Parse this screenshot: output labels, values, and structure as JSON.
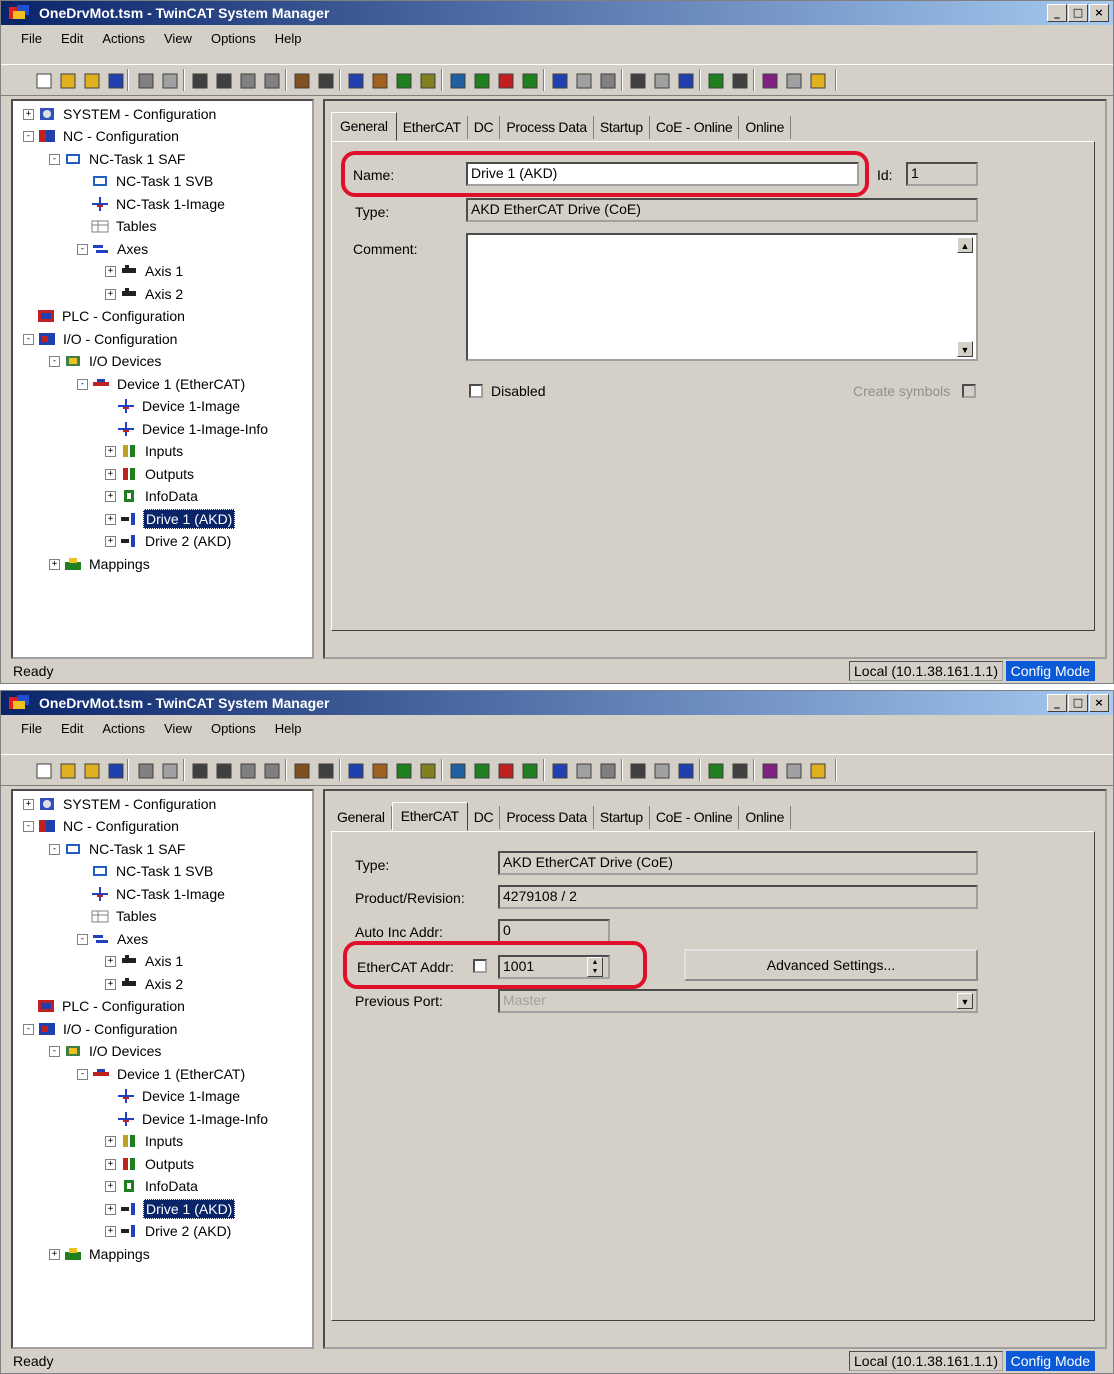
{
  "window1": {
    "title": "OneDrvMot.tsm - TwinCAT System Manager",
    "menu": [
      "File",
      "Edit",
      "Actions",
      "View",
      "Options",
      "Help"
    ],
    "tree": [
      {
        "label": "SYSTEM - Configuration"
      },
      {
        "label": "NC - Configuration"
      },
      {
        "label": "NC-Task 1 SAF"
      },
      {
        "label": "NC-Task 1 SVB"
      },
      {
        "label": "NC-Task 1-Image"
      },
      {
        "label": "Tables"
      },
      {
        "label": "Axes"
      },
      {
        "label": "Axis 1"
      },
      {
        "label": "Axis 2"
      },
      {
        "label": "PLC - Configuration"
      },
      {
        "label": "I/O - Configuration"
      },
      {
        "label": "I/O Devices"
      },
      {
        "label": "Device 1 (EtherCAT)"
      },
      {
        "label": "Device 1-Image"
      },
      {
        "label": "Device 1-Image-Info"
      },
      {
        "label": "Inputs"
      },
      {
        "label": "Outputs"
      },
      {
        "label": "InfoData"
      },
      {
        "label": "Drive 1 (AKD)"
      },
      {
        "label": "Drive 2 (AKD)"
      },
      {
        "label": "Mappings"
      }
    ],
    "tabs": [
      "General",
      "EtherCAT",
      "DC",
      "Process Data",
      "Startup",
      "CoE - Online",
      "Online"
    ],
    "active_tab": "General",
    "general": {
      "name_label": "Name:",
      "name_value": "Drive 1 (AKD)",
      "id_label": "Id:",
      "id_value": "1",
      "type_label": "Type:",
      "type_value": "AKD EtherCAT Drive (CoE)",
      "comment_label": "Comment:",
      "comment_value": "",
      "disabled_label": "Disabled",
      "create_symbols_label": "Create symbols"
    },
    "status": {
      "text": "Ready",
      "address": "Local (10.1.38.161.1.1)",
      "mode": "Config Mode"
    }
  },
  "window2": {
    "title": "OneDrvMot.tsm - TwinCAT System Manager",
    "menu": [
      "File",
      "Edit",
      "Actions",
      "View",
      "Options",
      "Help"
    ],
    "tree": [
      {
        "label": "SYSTEM - Configuration"
      },
      {
        "label": "NC - Configuration"
      },
      {
        "label": "NC-Task 1 SAF"
      },
      {
        "label": "NC-Task 1 SVB"
      },
      {
        "label": "NC-Task 1-Image"
      },
      {
        "label": "Tables"
      },
      {
        "label": "Axes"
      },
      {
        "label": "Axis 1"
      },
      {
        "label": "Axis 2"
      },
      {
        "label": "PLC - Configuration"
      },
      {
        "label": "I/O - Configuration"
      },
      {
        "label": "I/O Devices"
      },
      {
        "label": "Device 1 (EtherCAT)"
      },
      {
        "label": "Device 1-Image"
      },
      {
        "label": "Device 1-Image-Info"
      },
      {
        "label": "Inputs"
      },
      {
        "label": "Outputs"
      },
      {
        "label": "InfoData"
      },
      {
        "label": "Drive 1 (AKD)"
      },
      {
        "label": "Drive 2 (AKD)"
      },
      {
        "label": "Mappings"
      }
    ],
    "tabs": [
      "General",
      "EtherCAT",
      "DC",
      "Process Data",
      "Startup",
      "CoE - Online",
      "Online"
    ],
    "active_tab": "EtherCAT",
    "ethercat": {
      "type_label": "Type:",
      "type_value": "AKD EtherCAT Drive (CoE)",
      "product_label": "Product/Revision:",
      "product_value": "4279108 / 2",
      "auto_inc_label": "Auto Inc Addr:",
      "auto_inc_value": "0",
      "addr_label": "EtherCAT Addr:",
      "addr_value": "1001",
      "advanced_button": "Advanced Settings...",
      "prev_port_label": "Previous Port:",
      "prev_port_value": "Master"
    },
    "status": {
      "text": "Ready",
      "address": "Local (10.1.38.161.1.1)",
      "mode": "Config Mode"
    }
  },
  "colors": {
    "selection": "#0a246a",
    "highlight_oval": "#e0102a",
    "config_mode": "#0a5ad8"
  }
}
